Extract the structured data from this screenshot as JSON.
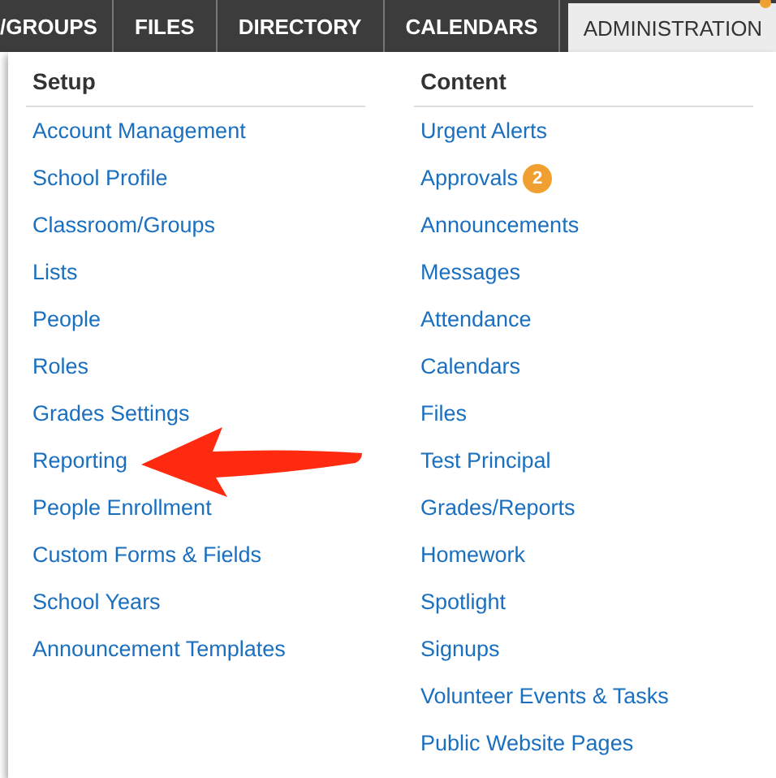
{
  "nav_tabs": [
    {
      "label": "/GROUPS",
      "selected": false
    },
    {
      "label": "FILES",
      "selected": false
    },
    {
      "label": "DIRECTORY",
      "selected": false
    },
    {
      "label": "CALENDARS",
      "selected": false
    },
    {
      "label": "ADMINISTRATION",
      "selected": true
    }
  ],
  "menu": {
    "columns": [
      {
        "title": "Setup",
        "items": [
          {
            "label": "Account Management"
          },
          {
            "label": "School Profile"
          },
          {
            "label": "Classroom/Groups"
          },
          {
            "label": "Lists"
          },
          {
            "label": "People"
          },
          {
            "label": "Roles"
          },
          {
            "label": "Grades Settings"
          },
          {
            "label": "Reporting"
          },
          {
            "label": "People Enrollment"
          },
          {
            "label": "Custom Forms & Fields"
          },
          {
            "label": "School Years"
          },
          {
            "label": "Announcement Templates"
          }
        ]
      },
      {
        "title": "Content",
        "items": [
          {
            "label": "Urgent Alerts"
          },
          {
            "label": "Approvals",
            "badge": "2"
          },
          {
            "label": "Announcements"
          },
          {
            "label": "Messages"
          },
          {
            "label": "Attendance"
          },
          {
            "label": "Calendars"
          },
          {
            "label": "Files"
          },
          {
            "label": "Test Principal"
          },
          {
            "label": "Grades/Reports"
          },
          {
            "label": "Homework"
          },
          {
            "label": "Spotlight"
          },
          {
            "label": "Signups"
          },
          {
            "label": "Volunteer Events & Tasks"
          },
          {
            "label": "Public Website Pages"
          }
        ]
      }
    ]
  }
}
